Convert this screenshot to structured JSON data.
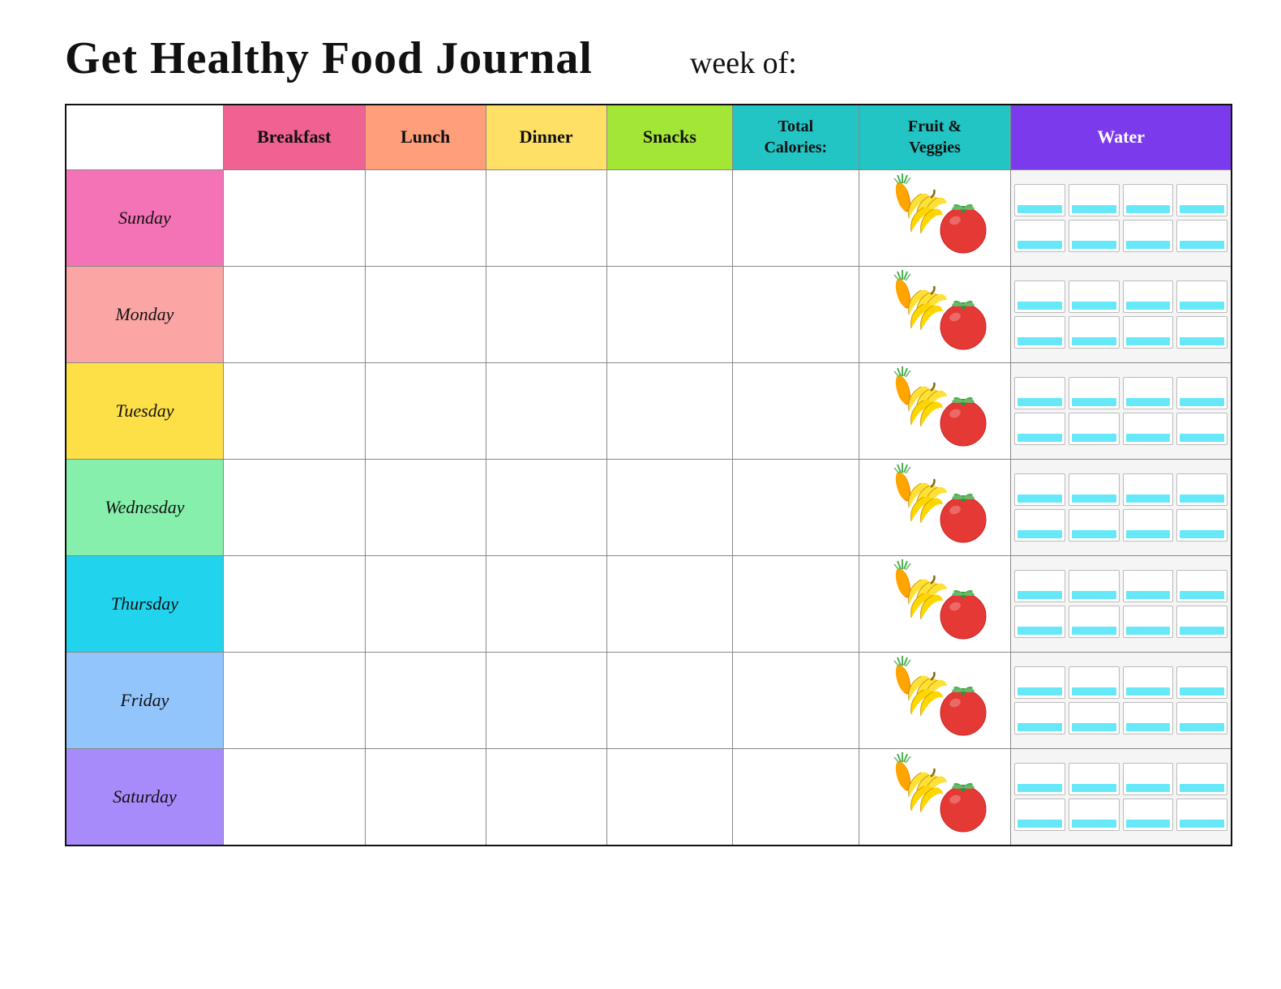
{
  "header": {
    "title": "Get Healthy Food Journal",
    "week_of_label": "week of:"
  },
  "columns": {
    "breakfast": "Breakfast",
    "lunch": "Lunch",
    "dinner": "Dinner",
    "snacks": "Snacks",
    "calories": "Total\nCalories:",
    "fruits": "Fruit &\nVeggies",
    "water": "Water"
  },
  "days": [
    {
      "name": "Sunday",
      "class": "day-cell-sunday"
    },
    {
      "name": "Monday",
      "class": "day-cell-monday"
    },
    {
      "name": "Tuesday",
      "class": "day-cell-tuesday"
    },
    {
      "name": "Wednesday",
      "class": "day-cell-wednesday"
    },
    {
      "name": "Thursday",
      "class": "day-cell-thursday"
    },
    {
      "name": "Friday",
      "class": "day-cell-friday"
    },
    {
      "name": "Saturday",
      "class": "day-cell-saturday"
    }
  ]
}
